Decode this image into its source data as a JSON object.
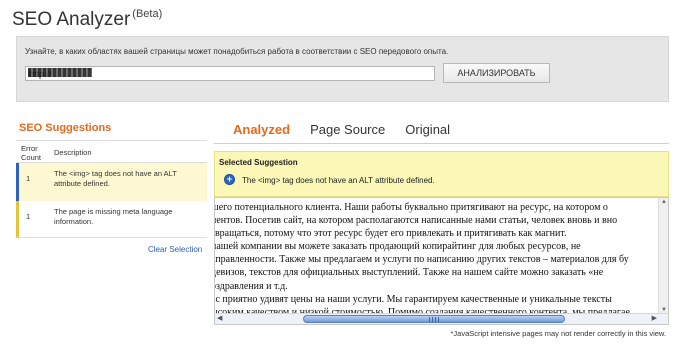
{
  "app": {
    "title": "SEO Analyzer",
    "beta": "(Beta)"
  },
  "top": {
    "description": "Узнайте, в каких областях вашей страницы может понадобиться работа в соответствии с SEO передового опыта.",
    "url_value": "http://",
    "analyze_label": "АНАЛИЗИРОВАТЬ"
  },
  "suggestions": {
    "title": "SEO Suggestions",
    "headers": {
      "error_count": "Error Count",
      "description": "Description"
    },
    "rows": [
      {
        "count": "1",
        "description": "The <img> tag does not have an ALT attribute defined."
      },
      {
        "count": "1",
        "description": "The page is missing meta language information."
      }
    ],
    "clear_label": "Clear Selection"
  },
  "tabs": [
    "Analyzed",
    "Page Source",
    "Original"
  ],
  "selected": {
    "title": "Selected Suggestion",
    "text": "The <img> tag does not have an ALT attribute defined."
  },
  "preview_lines": [
    "шего потенциального клиента. Наши работы буквально притягивают на ресурс, на котором о",
    "иентов. Посетив сайт, на котором располагаются написанные нами статьи, человек вновь и вно",
    "звращаться, потому что этот ресурс будет его привлекать и притягивать как магнит.",
    "нашей компании вы можете заказать продающий копирайтинг для любых ресурсов, не",
    "аправленности. Также мы предлагаем и услуги по написанию других текстов – материалов для бу",
    "девизов, текстов для официальных выступлений. Также на нашем сайте можно заказать «не",
    "оздравления и т.д.",
    "ас приятно удивят цены на наши услуги. Мы гарантируем качественные и уникальные тексты",
    "ысоким качеством и низкой стоимостью. Помимо создания качественного контента, мы предлагае"
  ],
  "footnote": "*JavaScript intensive pages may not render correctly in this view.",
  "colors": {
    "accent": "#e06b1f",
    "selected_bg": "#fbf7b7",
    "link": "#2a5db0"
  },
  "icons": {
    "selected": "plus-circle-icon"
  }
}
